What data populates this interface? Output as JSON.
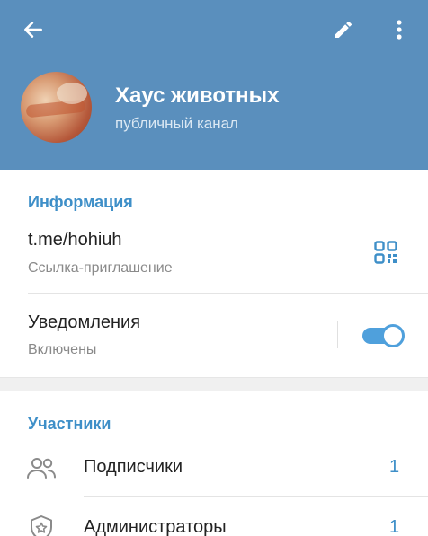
{
  "header": {
    "channel_name": "Хаус животных",
    "channel_type": "публичный канал",
    "background_color": "#5a8fbd",
    "icons": {
      "back": "arrow-left-icon",
      "edit": "pencil-icon",
      "more": "more-vertical-icon"
    }
  },
  "info": {
    "title": "Информация",
    "link": {
      "value": "t.me/hohiuh",
      "caption": "Ссылка-приглашение",
      "icon": "qr-code-icon"
    },
    "notifications": {
      "label": "Уведомления",
      "status": "Включены",
      "enabled": true
    }
  },
  "members": {
    "title": "Участники",
    "items": [
      {
        "label": "Подписчики",
        "count": "1",
        "icon": "users-icon"
      },
      {
        "label": "Администраторы",
        "count": "1",
        "icon": "admin-shield-icon"
      }
    ]
  },
  "colors": {
    "accent": "#3e8fc8",
    "toggle_on": "#4fa0dc"
  }
}
